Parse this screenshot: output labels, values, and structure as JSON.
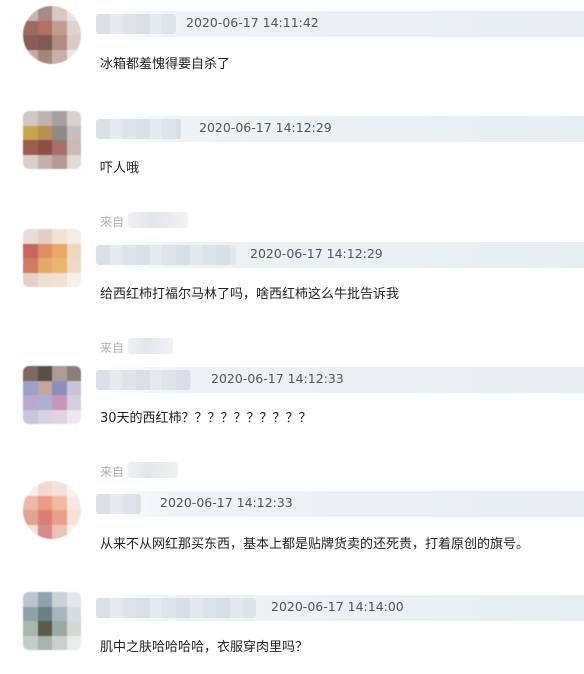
{
  "comments": [
    {
      "source": "",
      "time": "2020-06-17 14:11:42",
      "text": "冰箱都羞愧得要自杀了"
    },
    {
      "source": "",
      "time": "2020-06-17 14:12:29",
      "text": "吓人哦"
    },
    {
      "source": "来自",
      "time": "2020-06-17 14:12:29",
      "text": "给西红柿打福尔马林了吗，啥西红柿这么牛批告诉我"
    },
    {
      "source": "来自",
      "time": "2020-06-17 14:12:33",
      "text": "30天的西红柿？？？？？？？？？？"
    },
    {
      "source": "来自",
      "time": "2020-06-17 14:12:33",
      "text": "从来不从网红那买东西，基本上都是贴牌货卖的还死贵，打着原创的旗号。"
    },
    {
      "source": "",
      "time": "2020-06-17 14:14:00",
      "text": "肌中之肤哈哈哈哈，衣服穿肉里吗？"
    }
  ],
  "avatar_palettes": [
    [
      "#c9b5b3",
      "#a58a86",
      "#d8c6c2",
      "#ebe1de",
      "#9c6a62",
      "#b36f62",
      "#c49b8f",
      "#e0d2ce",
      "#8a5e57",
      "#7d5a55",
      "#b28b82",
      "#dcc9c3",
      "#c7aaa4",
      "#a7857e",
      "#c9b0aa",
      "#efe6e3"
    ],
    [
      "#cfc7c2",
      "#bdb3b0",
      "#a8a09d",
      "#d9d2cf",
      "#c9a54a",
      "#b78f55",
      "#8e8a86",
      "#c5beba",
      "#9d5c4e",
      "#8c5046",
      "#a8706a",
      "#cbb9b4",
      "#d8cfcc",
      "#c3b0ab",
      "#b59994",
      "#e2dad7"
    ],
    [
      "#e8dcd6",
      "#e2cfc4",
      "#f0e3d6",
      "#f4ece6",
      "#c8655d",
      "#de8e66",
      "#e9a865",
      "#efd6bf",
      "#cf7b63",
      "#e4a86b",
      "#e8b66f",
      "#efd9c5",
      "#e6cfc6",
      "#f0ded2",
      "#efe1d3",
      "#f6efea"
    ],
    [
      "#7e6960",
      "#5d4d48",
      "#aa9c94",
      "#8c7d79",
      "#9da1c8",
      "#c5a5a0",
      "#8b8fbd",
      "#c8c4d8",
      "#b8a8cf",
      "#a9b1d3",
      "#c996b8",
      "#d6cde2",
      "#c7c7dc",
      "#d8d1e4",
      "#e1d2e0",
      "#ece8f0"
    ],
    [
      "#f6efeb",
      "#f0d9cf",
      "#f4e2d9",
      "#faf5f2",
      "#eeb7a8",
      "#ec9a86",
      "#f0b9a4",
      "#f8e7e0",
      "#e4a28f",
      "#d97f74",
      "#ea9f8c",
      "#f6e0d8",
      "#f4dfd7",
      "#d98a8d",
      "#ecc1b4",
      "#fbf3f0"
    ],
    [
      "#b9c6cf",
      "#8da4b3",
      "#c8d2d8",
      "#e1e7ea",
      "#8ca3a8",
      "#6a7f86",
      "#a9b6b9",
      "#d4dcdf",
      "#a8b7ad",
      "#5c5a4a",
      "#9da9a0",
      "#d2d9d4",
      "#c4ccc8",
      "#a7b3ae",
      "#c8d0cc",
      "#e8ecea"
    ]
  ]
}
